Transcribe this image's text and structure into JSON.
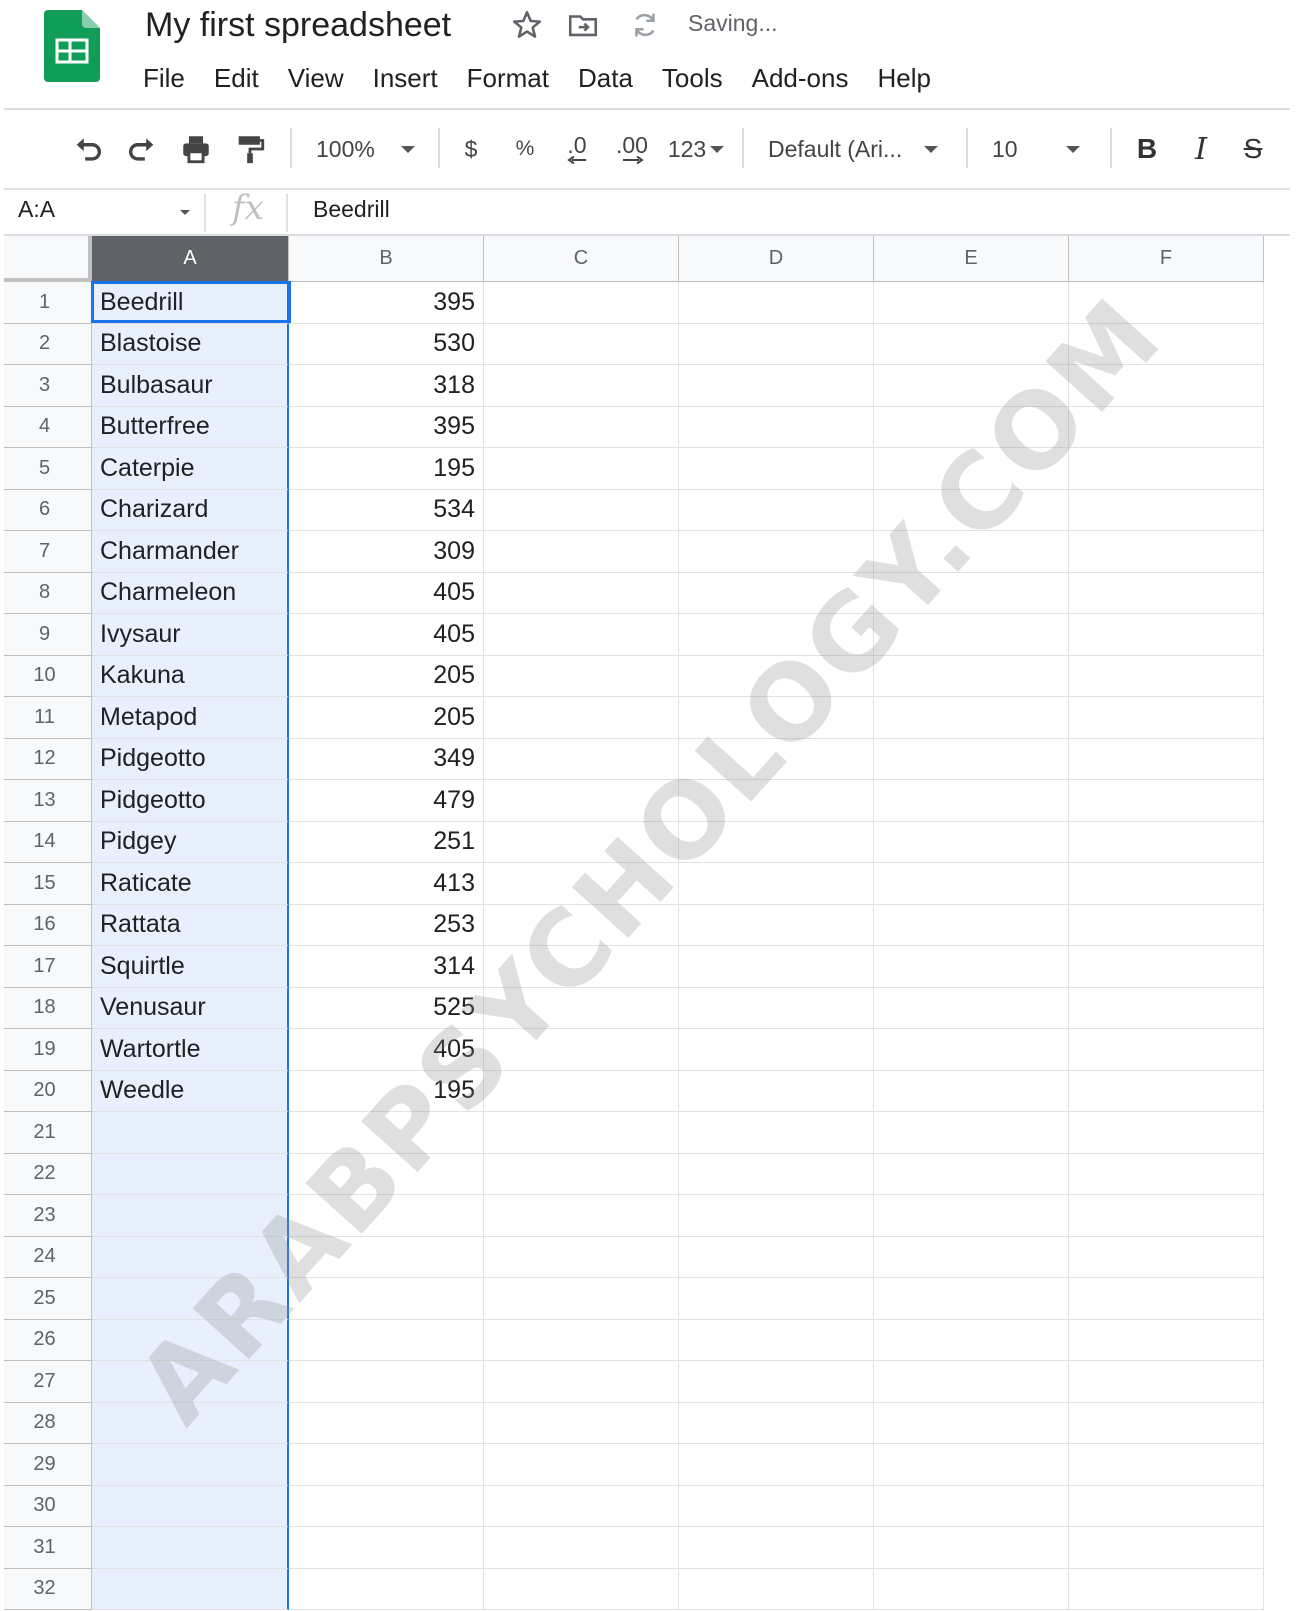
{
  "document": {
    "title": "My first spreadsheet",
    "status": "Saving..."
  },
  "menu": [
    "File",
    "Edit",
    "View",
    "Insert",
    "Format",
    "Data",
    "Tools",
    "Add-ons",
    "Help"
  ],
  "toolbar": {
    "zoom": "100%",
    "currency": "$",
    "percent": "%",
    "decrease_decimal": ".0",
    "increase_decimal": ".00",
    "more_formats": "123",
    "font": "Default (Ari...",
    "font_size": "10",
    "bold": "B",
    "italic": "I",
    "strikethrough": "S"
  },
  "formula_bar": {
    "name_box": "A:A",
    "fx": "fx",
    "value": "Beedrill"
  },
  "grid": {
    "columns": [
      "A",
      "B",
      "C",
      "D",
      "E",
      "F"
    ],
    "selected_column": "A",
    "row_numbers": [
      "1",
      "2",
      "3",
      "4",
      "5",
      "6",
      "7",
      "8",
      "9",
      "10",
      "11",
      "12",
      "13",
      "14",
      "15",
      "16",
      "17",
      "18",
      "19",
      "20",
      "21",
      "22",
      "23",
      "24",
      "25",
      "26",
      "27",
      "28",
      "29",
      "30",
      "31",
      "32"
    ],
    "data": [
      [
        "Beedrill",
        "395"
      ],
      [
        "Blastoise",
        "530"
      ],
      [
        "Bulbasaur",
        "318"
      ],
      [
        "Butterfree",
        "395"
      ],
      [
        "Caterpie",
        "195"
      ],
      [
        "Charizard",
        "534"
      ],
      [
        "Charmander",
        "309"
      ],
      [
        "Charmeleon",
        "405"
      ],
      [
        "Ivysaur",
        "405"
      ],
      [
        "Kakuna",
        "205"
      ],
      [
        "Metapod",
        "205"
      ],
      [
        "Pidgeotto",
        "349"
      ],
      [
        "Pidgeotto",
        "479"
      ],
      [
        "Pidgey",
        "251"
      ],
      [
        "Raticate",
        "413"
      ],
      [
        "Rattata",
        "253"
      ],
      [
        "Squirtle",
        "314"
      ],
      [
        "Venusaur",
        "525"
      ],
      [
        "Wartortle",
        "405"
      ],
      [
        "Weedle",
        "195"
      ]
    ]
  },
  "watermark": "ARABPSYCHOLOGY.COM",
  "colors": {
    "sheets_green": "#0f9d58",
    "selection_blue": "#1a73e8",
    "selection_fill": "#e8f0fe",
    "header_selected": "#5f6368"
  },
  "icons": [
    "sheets-logo-icon",
    "star-icon",
    "move-to-folder-icon",
    "sync-icon",
    "undo-icon",
    "redo-icon",
    "print-icon",
    "paint-format-icon"
  ]
}
